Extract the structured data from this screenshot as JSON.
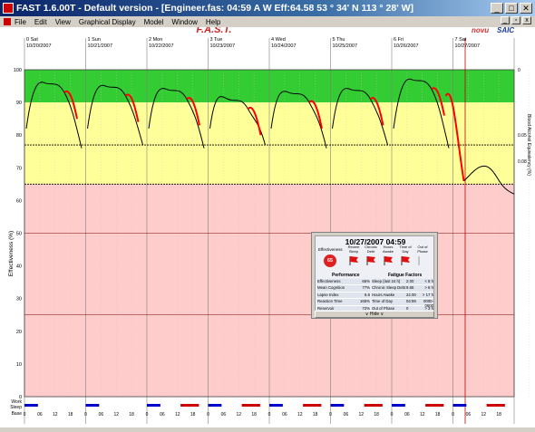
{
  "window": {
    "title": "FAST 1.6.00T - Default version - [Engineer.fas: 04:59 A W Eff:64.58  53 ° 34' N 113 ° 28' W]",
    "min_label": "_",
    "max_label": "□",
    "close_label": "✕"
  },
  "menu": {
    "items": [
      "File",
      "Edit",
      "View",
      "Graphical Display",
      "Model",
      "Window",
      "Help"
    ]
  },
  "header": {
    "logo_text": "F.A.S.T.",
    "brand_left": "novu",
    "brand_right": "SAIC"
  },
  "days": [
    {
      "label": "0 Sat",
      "date": "10/20/2007"
    },
    {
      "label": "1 Sun",
      "date": "10/21/2007"
    },
    {
      "label": "2 Mon",
      "date": "10/22/2007"
    },
    {
      "label": "3 Tue",
      "date": "10/23/2007"
    },
    {
      "label": "4 Wed",
      "date": "10/24/2007"
    },
    {
      "label": "5 Thu",
      "date": "10/25/2007"
    },
    {
      "label": "6 Fri",
      "date": "10/26/2007"
    },
    {
      "label": "7 Sat",
      "date": "10/27/2007"
    }
  ],
  "axes": {
    "left_label": "Effectiveness (%)",
    "right_label": "Blood Alcohol Equivalency (%)",
    "left_ticks": [
      "100",
      "90",
      "80",
      "70",
      "60",
      "50",
      "40",
      "30",
      "20",
      "10",
      "0"
    ],
    "right_ticks": [
      "0",
      "0.05",
      "0.08"
    ],
    "hour_ticks": [
      "0",
      "06",
      "12",
      "18"
    ],
    "row_labels": [
      "Work",
      "Sleep",
      "Base"
    ]
  },
  "colors": {
    "green": "#33cc33",
    "yellow": "#ffff99",
    "pink": "#ffcccc",
    "curve": "#000000",
    "curve_alt": "#b0b0b0",
    "warn": "#ff0000",
    "sleep": "#0000cc",
    "work": "#cc0000"
  },
  "chart_data": {
    "type": "line",
    "ylim": [
      0,
      100
    ],
    "reference_lines": [
      77,
      65
    ],
    "thresholds": {
      "green_above": 90,
      "yellow_above": 65
    },
    "cursor_day": 7.2
  },
  "popup": {
    "title": "10/27/2007 04:59",
    "effectiveness_label": "Effectiveness",
    "effectiveness_value": "65",
    "flags": [
      {
        "label": "Recent Sleep"
      },
      {
        "label": "Chronic Debt"
      },
      {
        "label": "Hours Awake"
      },
      {
        "label": "Time of Day"
      },
      {
        "label": "Out of Phase"
      }
    ],
    "perf_header": "Performance",
    "fatigue_header": "Fatigue Factors",
    "perf_rows": [
      {
        "name": "Effectiveness",
        "value": "65%"
      },
      {
        "name": "Mean Cognition",
        "value": "77%"
      },
      {
        "name": "Lapse Index",
        "value": "6.6"
      },
      {
        "name": "Reaction Time",
        "value": "165%"
      },
      {
        "name": "Reservoir",
        "value": "72%"
      }
    ],
    "fatigue_rows": [
      {
        "name": "Sleep (last 24 h)",
        "value": "2.00",
        "limit": "< 8 h"
      },
      {
        "name": "Chronic Sleep Debt",
        "value": "9.65",
        "limit": "> 8 h"
      },
      {
        "name": "Hours Awake",
        "value": "22.00",
        "limit": "> 17 h"
      },
      {
        "name": "Time of Day",
        "value": "04:59",
        "limit": "0000-0600"
      },
      {
        "name": "Out of Phase",
        "value": "0",
        "limit": "> 3 h"
      }
    ],
    "hide_label": "∨ Hide ∨"
  }
}
